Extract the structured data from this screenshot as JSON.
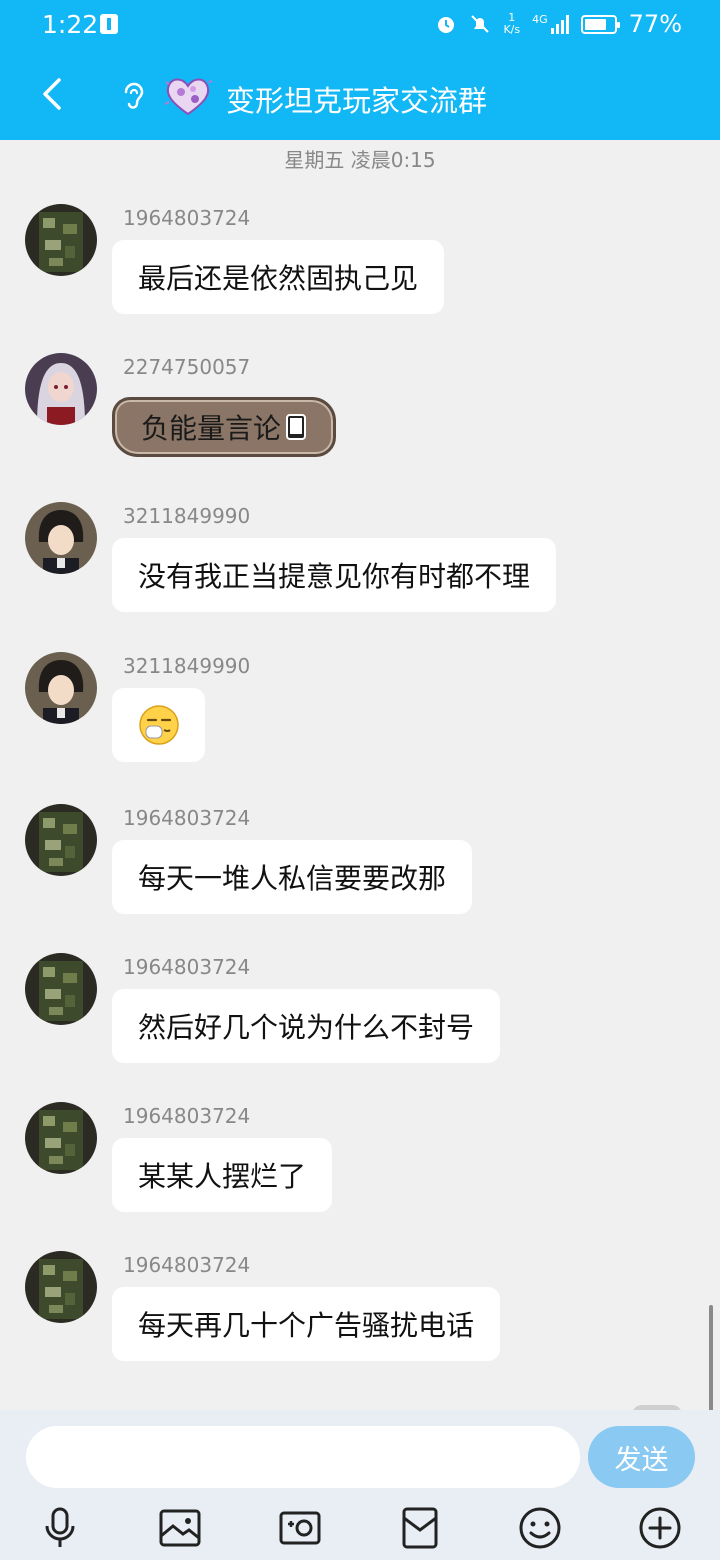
{
  "status_bar": {
    "time": "1:22",
    "net_speed_value": "1",
    "net_speed_unit": "K/s",
    "network_type": "4G",
    "battery_percent": "77%",
    "battery_level": 0.77
  },
  "header": {
    "title": "变形坦克玩家交流群"
  },
  "chat": {
    "time_divider": "星期五 凌晨0:15",
    "messages": [
      {
        "sender": "1964803724",
        "text": "最后还是依然固执己见",
        "avatar": "camo-avatar"
      },
      {
        "sender": "2274750057",
        "text": "负能量言论",
        "avatar": "anime-girl-avatar",
        "style": "mud-bubble"
      },
      {
        "sender": "3211849990",
        "text": "没有我正当提意见你有时都不理",
        "avatar": "anime-boy-avatar"
      },
      {
        "sender": "3211849990",
        "text": "",
        "emoji": "mask-face-emoji",
        "avatar": "anime-boy-avatar"
      },
      {
        "sender": "1964803724",
        "text": "每天一堆人私信要要改那",
        "avatar": "camo-avatar"
      },
      {
        "sender": "1964803724",
        "text": "然后好几个说为什么不封号",
        "avatar": "camo-avatar"
      },
      {
        "sender": "1964803724",
        "text": "某某人摆烂了",
        "avatar": "camo-avatar"
      },
      {
        "sender": "1964803724",
        "text": "每天再几十个广告骚扰电话",
        "avatar": "camo-avatar"
      }
    ]
  },
  "composer": {
    "input_value": "",
    "send_label": "发送"
  },
  "toolbar": {
    "icons": [
      "microphone-icon",
      "image-icon",
      "camera-icon",
      "envelope-icon",
      "emoji-icon",
      "plus-icon"
    ]
  },
  "colors": {
    "header": "#12b7f5",
    "send_button": "#8ac9f2",
    "chat_background": "#f0f0f0"
  }
}
